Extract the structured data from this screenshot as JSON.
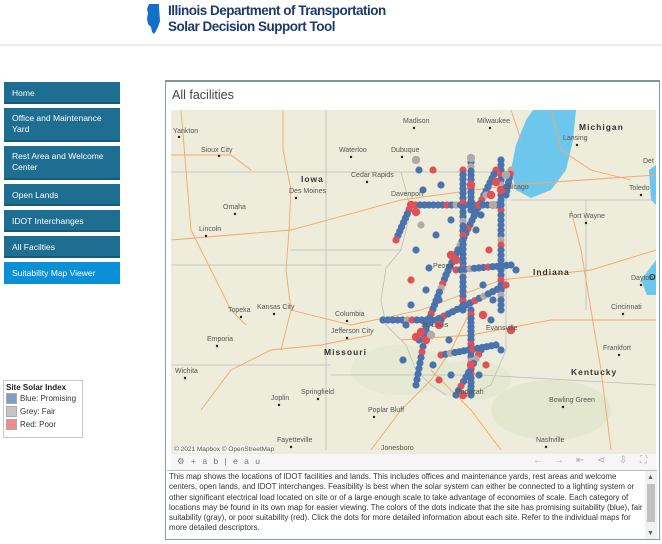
{
  "header": {
    "title_line1": "Illinois Department of Transportation",
    "title_line2": "Solar Decision Support Tool",
    "logo_icon": "illinois-state-shape-icon"
  },
  "nav": {
    "items": [
      {
        "label": "Home",
        "active": false
      },
      {
        "label": "Office and Maintenance Yard",
        "active": false
      },
      {
        "label": "Rest Area and Welcome Center",
        "active": false
      },
      {
        "label": "Open Lands",
        "active": false
      },
      {
        "label": "IDOT Interchanges",
        "active": false
      },
      {
        "label": "All Facilties",
        "active": false
      },
      {
        "label": "Suitability Map Viewer",
        "active": true
      }
    ]
  },
  "legend": {
    "title": "Site Solar Index",
    "items": [
      {
        "label": "Blue: Promising",
        "color": "#7d9ec9"
      },
      {
        "label": "Grey: Fair",
        "color": "#c9c4c4"
      },
      {
        "label": "Red: Poor",
        "color": "#ef8a8f"
      }
    ]
  },
  "panel": {
    "title": "All facilities",
    "attribution": "© 2021 Mapbox  © OpenStreetMap",
    "toolbar": {
      "brand": "+ a b | e a u",
      "undo_icon": "←",
      "redo_icon": "→",
      "revert_icon": "⇤",
      "share_icon": "share-icon",
      "download_icon": "download-icon",
      "fullscreen_icon": "fullscreen-icon"
    },
    "description": "This map shows the locations of IDOT facilities and lands. This includes offices and maintenance yards, rest areas and welcome centers, open lands, and IDOT interchanges. Feasibility is best when the solar system can either be connected to a lighting system or other significant electrical load located on site or of a large enough scale to take advantage of economies of scale. Each category of locations may be found in its own map for easier viewing. The colors of the dots indicate that the site has promising suitability (blue), fair suitability (gray), or poor suitability (red). Click the dots for more detailed information about each site. Refer to the individual maps for more detailed descriptors."
  },
  "map": {
    "colors": {
      "promising": "#4a72ad",
      "fair": "#b3a9a6",
      "poor": "#e05058",
      "water": "#6dc7ec",
      "land": "#eeecdb",
      "road": "#f4a66a",
      "border": "#bdbdbd"
    },
    "cities": [
      {
        "name": "Yankton"
      },
      {
        "name": "Sioux City"
      },
      {
        "name": "Waterloo"
      },
      {
        "name": "Dubuque"
      },
      {
        "name": "Madison"
      },
      {
        "name": "Milwaukee"
      },
      {
        "name": "Lansing"
      },
      {
        "name": "Det"
      },
      {
        "name": "Cedar Rapids"
      },
      {
        "name": "Des Moines"
      },
      {
        "name": "Davenport"
      },
      {
        "name": "Omaha"
      },
      {
        "name": "Lincoln"
      },
      {
        "name": "Toledo"
      },
      {
        "name": "Fort Wayne"
      },
      {
        "name": "Dayton"
      },
      {
        "name": "Cincinnati"
      },
      {
        "name": "Frankfort"
      },
      {
        "name": "Topeka"
      },
      {
        "name": "Kansas City"
      },
      {
        "name": "Columbia"
      },
      {
        "name": "Jefferson City"
      },
      {
        "name": "Emporia"
      },
      {
        "name": "Wichita"
      },
      {
        "name": "Springfield"
      },
      {
        "name": "Joplin"
      },
      {
        "name": "Poplar Bluff"
      },
      {
        "name": "Evansville"
      },
      {
        "name": "Paducah"
      },
      {
        "name": "Bowling Green"
      },
      {
        "name": "Nashville"
      },
      {
        "name": "Fayetteville"
      },
      {
        "name": "Jonesboro"
      },
      {
        "name": "Peoria"
      },
      {
        "name": "St. Louis"
      },
      {
        "name": "Chicago"
      }
    ],
    "states": [
      "Iowa",
      "Michigan",
      "Indiana",
      "Missouri",
      "Kentucky",
      "Ol"
    ]
  }
}
